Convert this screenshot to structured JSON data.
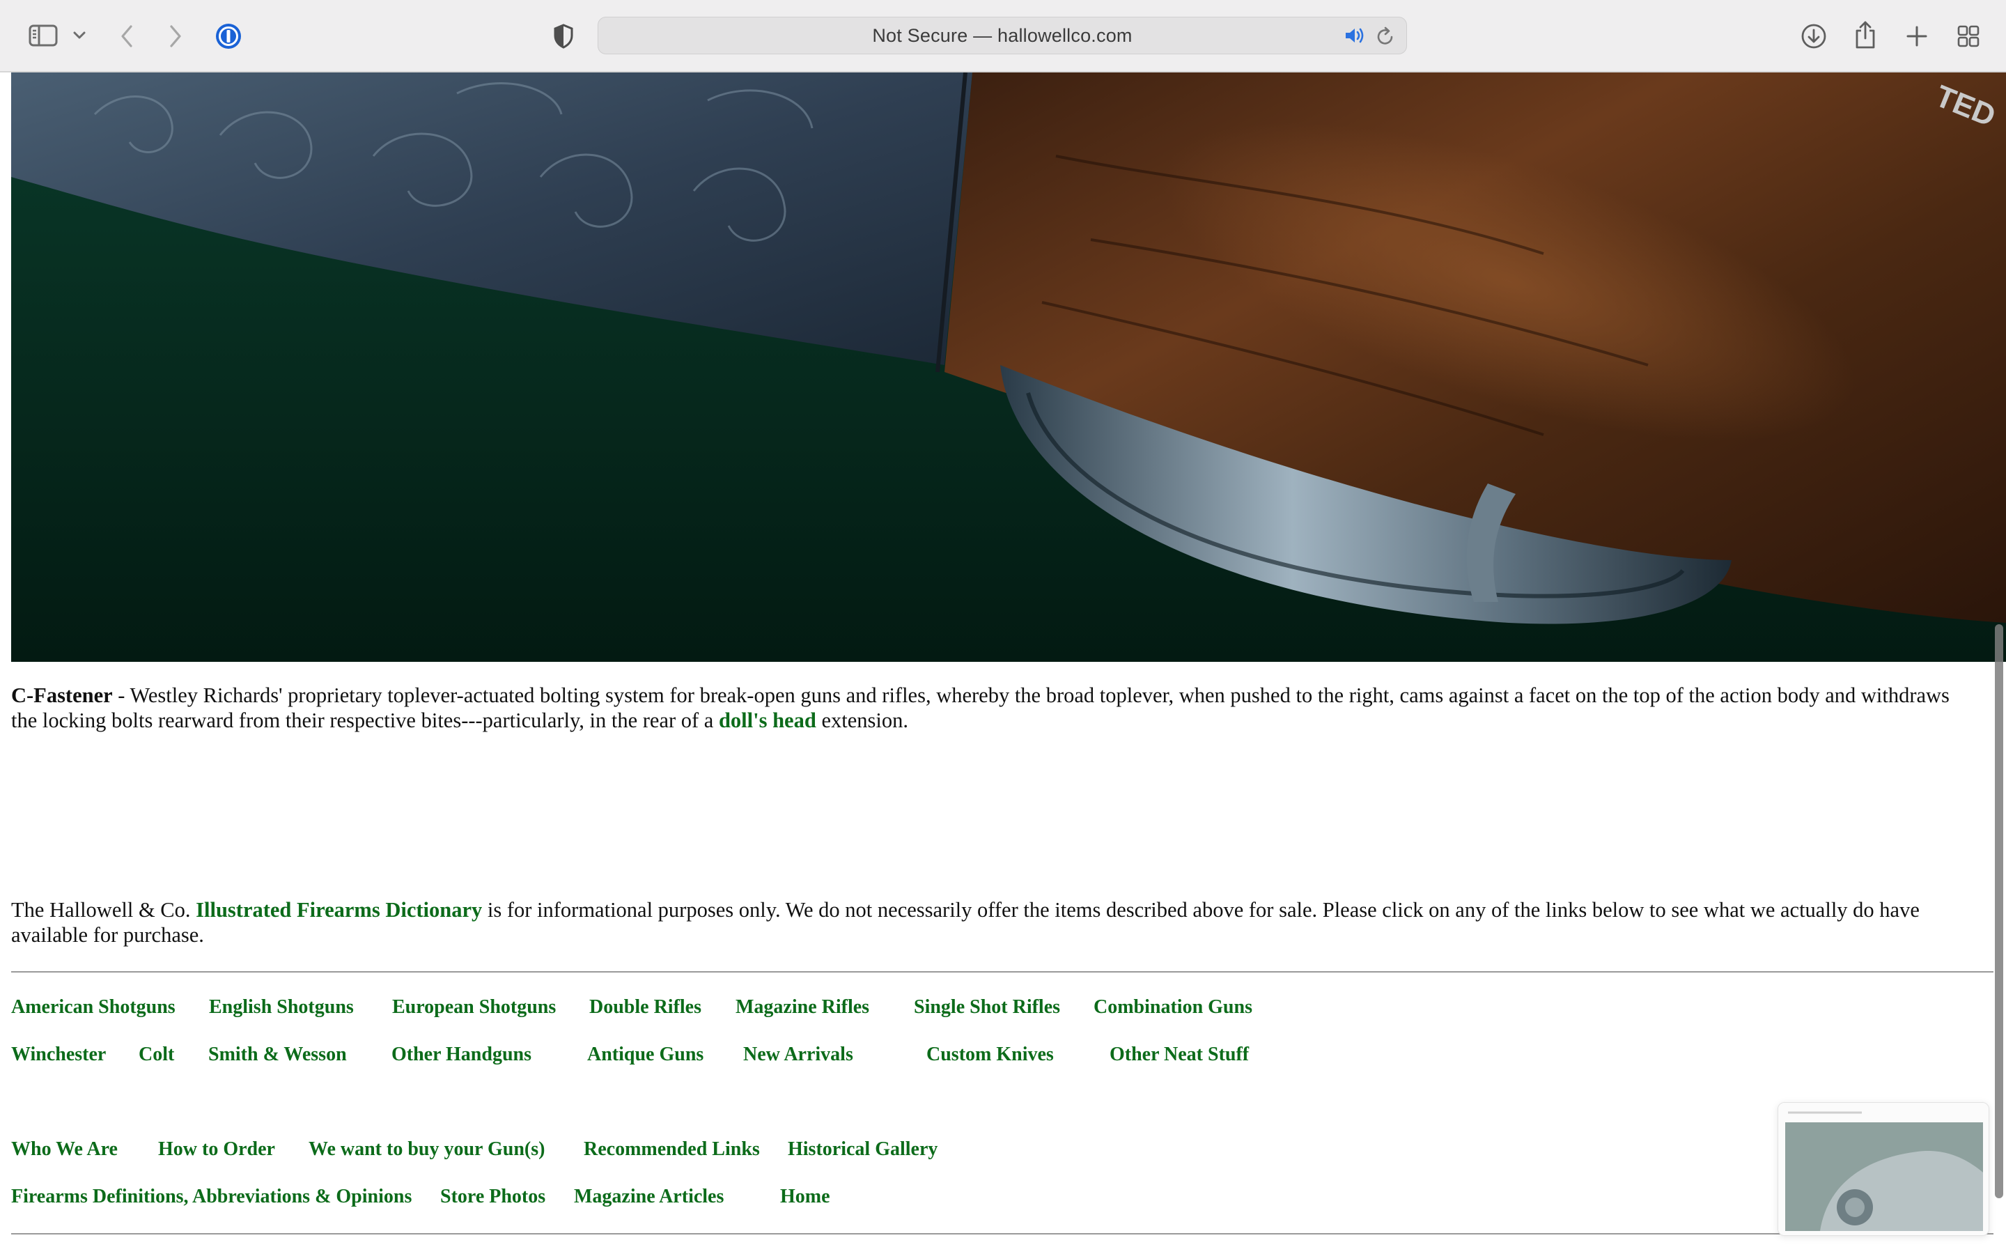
{
  "browser": {
    "address": "Not Secure — hallowellco.com"
  },
  "article": {
    "term": "C-Fastener",
    "definition_part1": " - Westley Richards' proprietary toplever-actuated bolting system for break-open guns and rifles, whereby the broad toplever, when pushed to the right, cams against a facet on the top of the action body and withdraws the locking bolts rearward from their respective bites---particularly, in the rear of a ",
    "definition_link": "doll's head",
    "definition_part2": " extension."
  },
  "disclaimer": {
    "part1": "The Hallowell & Co. ",
    "link": "Illustrated Firearms Dictionary",
    "part2": " is for informational purposes only. We do not necessarily offer the items described above for sale. Please click on any of the links below to see what we actually do have available for purchase."
  },
  "nav": {
    "row1": [
      "American Shotguns",
      "English Shotguns",
      "European Shotguns",
      "Double Rifles",
      "Magazine Rifles",
      "Single Shot Rifles",
      "Combination Guns"
    ],
    "row2": [
      "Winchester",
      "Colt",
      "Smith & Wesson",
      "Other Handguns",
      "Antique Guns",
      "New Arrivals",
      "Custom Knives",
      "Other Neat Stuff"
    ],
    "row3": [
      "Who We Are",
      "How to Order",
      "We want to buy your Gun(s)",
      "Recommended Links",
      "Historical Gallery"
    ],
    "row4": [
      "Firearms Definitions, Abbreviations & Opinions",
      "Store Photos",
      "Magazine Articles",
      "Home"
    ]
  },
  "icons": {
    "toolbar": [
      "sidebar-icon",
      "chevron-down-icon",
      "back-icon",
      "forward-icon",
      "password-manager-icon",
      "privacy-shield-icon",
      "audio-icon",
      "reload-icon",
      "download-icon",
      "share-icon",
      "new-tab-icon",
      "tab-overview-icon"
    ]
  },
  "colors": {
    "link": "#0c6b1a",
    "hero_bg": "#062b1f"
  }
}
